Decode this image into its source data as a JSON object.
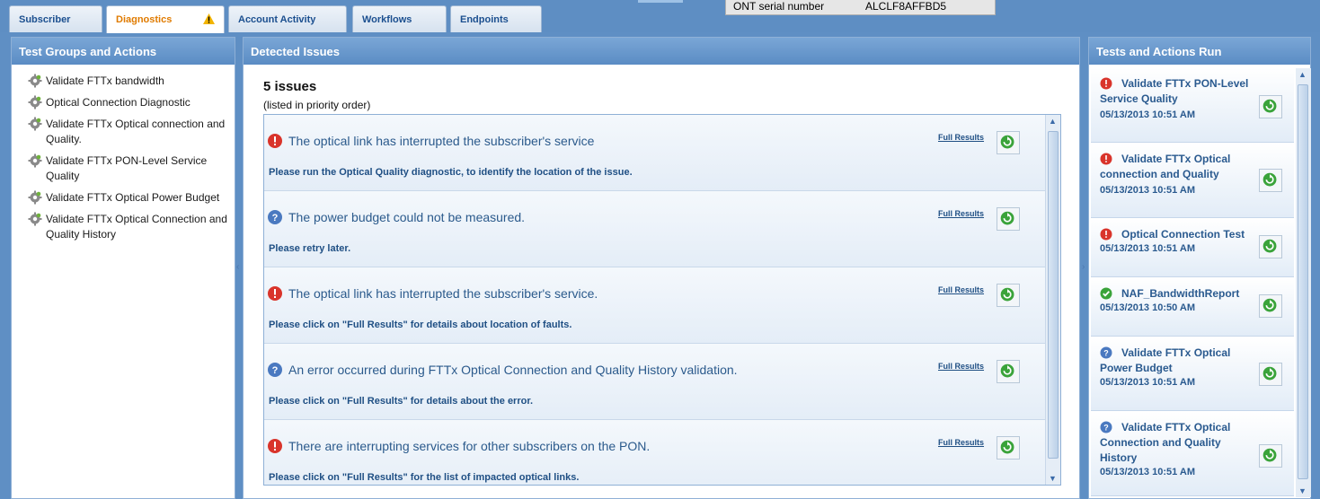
{
  "tabs": [
    {
      "label": "Subscriber",
      "active": false
    },
    {
      "label": "Diagnostics",
      "active": true,
      "warning": true
    },
    {
      "label": "Account Activity",
      "active": false
    },
    {
      "label": "Workflows",
      "active": false
    },
    {
      "label": "Endpoints",
      "active": false
    }
  ],
  "ont": {
    "label": "ONT serial number",
    "value": "ALCLF8AFFBD5"
  },
  "left": {
    "title": "Test Groups and Actions",
    "items": [
      {
        "label": "Validate FTTx bandwidth",
        "icon": "gear-icon"
      },
      {
        "label": "Optical Connection Diagnostic",
        "icon": "gear-icon"
      },
      {
        "label": "Validate FTTx Optical connection and Quality.",
        "icon": "gear-icon"
      },
      {
        "label": "Validate FTTx PON-Level Service Quality",
        "icon": "gear-icon"
      },
      {
        "label": "Validate FTTx Optical Power Budget",
        "icon": "gear-icon"
      },
      {
        "label": "Validate FTTx Optical Connection and Quality History",
        "icon": "gear-icon"
      }
    ]
  },
  "middle": {
    "title": "Detected Issues",
    "count": "5 issues",
    "sub": "(listed in priority order)",
    "full_results_label": "Full Results",
    "issues": [
      {
        "severity": "error",
        "title": "The optical link has interrupted the subscriber's service",
        "desc": "Please run the Optical Quality diagnostic, to identify the location of the issue."
      },
      {
        "severity": "unknown",
        "title": "The power budget could not be measured.",
        "desc": "Please retry later."
      },
      {
        "severity": "error",
        "title": "The optical link has interrupted the subscriber's service.",
        "desc": "Please click on \"Full Results\" for details about location of faults."
      },
      {
        "severity": "unknown",
        "title": "An error occurred during FTTx Optical Connection and Quality History validation.",
        "desc": "Please click on \"Full Results\" for details about the error."
      },
      {
        "severity": "error",
        "title": "There are interrupting services for other subscribers on the PON.",
        "desc": "Please click on \"Full Results\" for the list of impacted optical links."
      }
    ]
  },
  "right": {
    "title": "Tests and Actions Run",
    "items": [
      {
        "status": "error",
        "name": "Validate FTTx PON-Level Service Quality",
        "time": "05/13/2013 10:51 AM"
      },
      {
        "status": "error",
        "name": "Validate FTTx Optical connection and Quality",
        "time": "05/13/2013 10:51 AM"
      },
      {
        "status": "error",
        "name": "Optical Connection Test",
        "time": "05/13/2013 10:51 AM"
      },
      {
        "status": "ok",
        "name": "NAF_BandwidthReport",
        "time": "05/13/2013 10:50 AM"
      },
      {
        "status": "unknown",
        "name": "Validate FTTx Optical Power Budget",
        "time": "05/13/2013 10:51 AM"
      },
      {
        "status": "unknown",
        "name": "Validate FTTx Optical Connection and Quality History",
        "time": "05/13/2013 10:51 AM"
      }
    ]
  },
  "colors": {
    "error": "#d9342b",
    "unknown": "#4a79c0",
    "ok": "#3aa33a",
    "accent": "#e07b00"
  }
}
